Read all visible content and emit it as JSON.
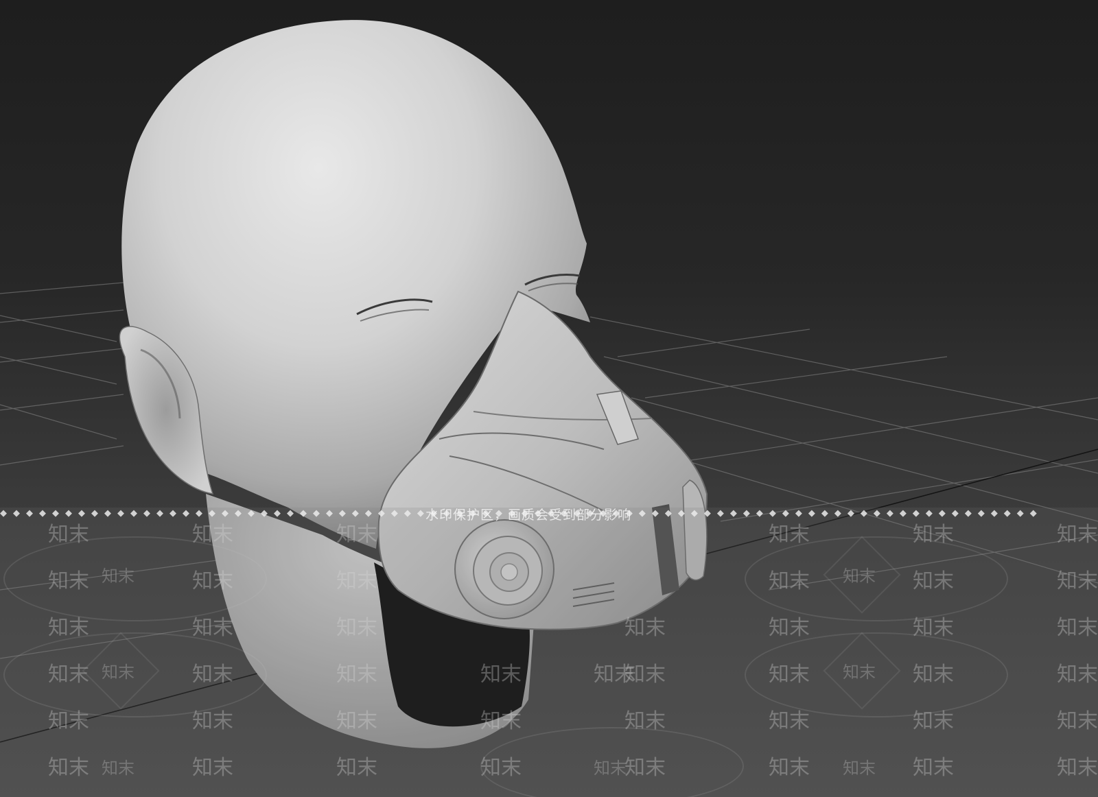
{
  "viewport": {
    "label": "3D viewport - shaded head with respirator mask",
    "grid_color": "#8a8a8a",
    "background_top": "#1e1e1e",
    "background_bottom": "#4a4a4a"
  },
  "model": {
    "head_color": "#c9c9c9",
    "mask_color": "#bdbdbd",
    "beard_color": "#0e0e0e"
  },
  "watermark": {
    "protect_text": "水印保护区，画质会受到部分影响",
    "dot_glyph": "◆",
    "brand": "知末"
  }
}
